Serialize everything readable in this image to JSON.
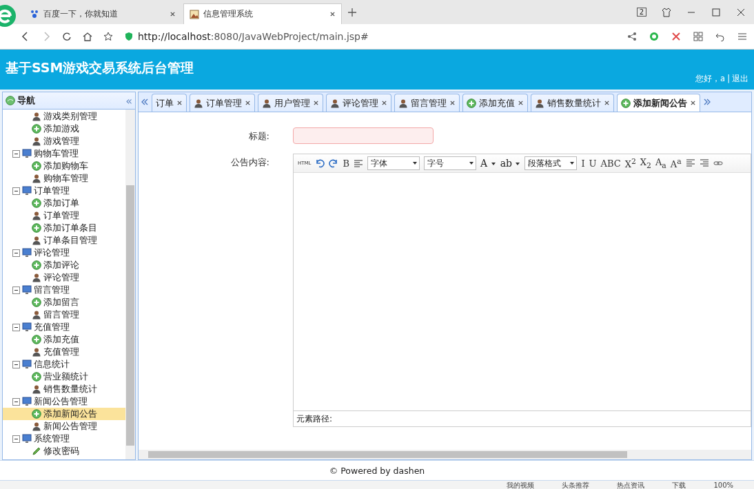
{
  "browser": {
    "tabs": [
      {
        "label": "百度一下，你就知道",
        "selected": false
      },
      {
        "label": "信息管理系统",
        "selected": true
      }
    ],
    "url_host": "http://localhost",
    "url_rest": ":8080/JavaWebProject/main.jsp#",
    "counter": "2"
  },
  "header": {
    "title": "基于SSM游戏交易系统后台管理",
    "greeting": "您好，a",
    "separator": "|",
    "logout": "退出"
  },
  "nav": {
    "title": "导航",
    "collapse": "«",
    "tree": [
      {
        "children": [
          {
            "label": "游戏类别管理",
            "kind": "manage",
            "selected": false
          },
          {
            "label": "添加游戏",
            "kind": "add",
            "selected": false
          },
          {
            "label": "游戏管理",
            "kind": "manage",
            "selected": false
          }
        ]
      },
      {
        "label": "购物车管理",
        "expanded": true,
        "children": [
          {
            "label": "添加购物车",
            "kind": "add",
            "selected": false
          },
          {
            "label": "购物车管理",
            "kind": "manage",
            "selected": false
          }
        ]
      },
      {
        "label": "订单管理",
        "expanded": true,
        "children": [
          {
            "label": "添加订单",
            "kind": "add",
            "selected": false
          },
          {
            "label": "订单管理",
            "kind": "manage",
            "selected": false
          },
          {
            "label": "添加订单条目",
            "kind": "add",
            "selected": false
          },
          {
            "label": "订单条目管理",
            "kind": "manage",
            "selected": false
          }
        ]
      },
      {
        "label": "评论管理",
        "expanded": true,
        "children": [
          {
            "label": "添加评论",
            "kind": "add",
            "selected": false
          },
          {
            "label": "评论管理",
            "kind": "manage",
            "selected": false
          }
        ]
      },
      {
        "label": "留言管理",
        "expanded": true,
        "children": [
          {
            "label": "添加留言",
            "kind": "add",
            "selected": false
          },
          {
            "label": "留言管理",
            "kind": "manage",
            "selected": false
          }
        ]
      },
      {
        "label": "充值管理",
        "expanded": true,
        "children": [
          {
            "label": "添加充值",
            "kind": "add",
            "selected": false
          },
          {
            "label": "充值管理",
            "kind": "manage",
            "selected": false
          }
        ]
      },
      {
        "label": "信息统计",
        "expanded": true,
        "children": [
          {
            "label": "营业额统计",
            "kind": "add",
            "selected": false
          },
          {
            "label": "销售数量统计",
            "kind": "manage",
            "selected": false
          }
        ]
      },
      {
        "label": "新闻公告管理",
        "expanded": true,
        "children": [
          {
            "label": "添加新闻公告",
            "kind": "add",
            "selected": true
          },
          {
            "label": "新闻公告管理",
            "kind": "manage",
            "selected": false
          }
        ]
      },
      {
        "label": "系统管理",
        "expanded": true,
        "children": [
          {
            "label": "修改密码",
            "kind": "edit",
            "selected": false
          }
        ]
      }
    ]
  },
  "tabs": [
    {
      "label": "订单",
      "kind": "none",
      "selected": false
    },
    {
      "label": "订单管理",
      "kind": "manage",
      "selected": false
    },
    {
      "label": "用户管理",
      "kind": "manage",
      "selected": false
    },
    {
      "label": "评论管理",
      "kind": "manage",
      "selected": false
    },
    {
      "label": "留言管理",
      "kind": "manage",
      "selected": false
    },
    {
      "label": "添加充值",
      "kind": "add",
      "selected": false
    },
    {
      "label": "销售数量统计",
      "kind": "manage",
      "selected": false
    },
    {
      "label": "添加新闻公告",
      "kind": "add",
      "selected": true
    }
  ],
  "form": {
    "title_label": "标题:",
    "content_label": "公告内容:",
    "element_path": "元素路径:",
    "toolbar": [
      {
        "kind": "html",
        "label": "HTML"
      },
      {
        "kind": "undo"
      },
      {
        "kind": "redo"
      },
      {
        "kind": "text",
        "label": "B"
      },
      {
        "kind": "format"
      },
      {
        "kind": "select",
        "label": "字体"
      },
      {
        "kind": "select",
        "label": "字号"
      },
      {
        "kind": "dropdown",
        "label": "A"
      },
      {
        "kind": "dropdown",
        "label": "ab"
      },
      {
        "kind": "select",
        "label": "段落格式"
      },
      {
        "kind": "text",
        "label": "I"
      },
      {
        "kind": "text",
        "label": "U"
      },
      {
        "kind": "text",
        "label": "ABC"
      },
      {
        "kind": "text",
        "label": "X$^{2}$"
      },
      {
        "kind": "text",
        "label": "X$_{2}$"
      },
      {
        "kind": "text",
        "label": "A$_{a}$"
      },
      {
        "kind": "text",
        "label": "A$^{a}$"
      },
      {
        "kind": "align-left"
      },
      {
        "kind": "align-right"
      },
      {
        "kind": "link"
      }
    ]
  },
  "footer": "© Powered by dashen",
  "status_bar": [
    "我的视频",
    "头条推荐",
    "热点资讯",
    "下载",
    "100%"
  ]
}
